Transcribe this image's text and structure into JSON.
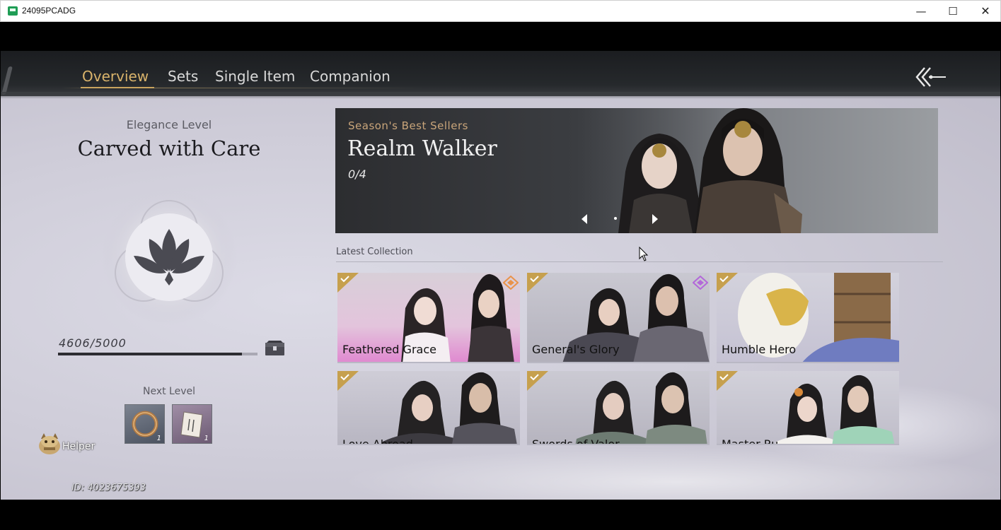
{
  "window": {
    "title": "24095PCADG",
    "minimize": "—",
    "maximize": "☐",
    "close": "✕"
  },
  "nav": {
    "tabs": [
      {
        "label": "Overview",
        "active": true
      },
      {
        "label": "Sets",
        "active": false
      },
      {
        "label": "Single Item",
        "active": false
      },
      {
        "label": "Companion",
        "active": false
      }
    ],
    "back_icon": "back-arrow-icon",
    "active_color": "#d9b36b"
  },
  "elegance": {
    "label": "Elegance Level",
    "name": "Carved with Care",
    "emblem_icon": "lotus-icon",
    "progress_text": "4606/5000",
    "progress_fraction": 0.9212,
    "reward_chest_icon": "chest-icon"
  },
  "next_level": {
    "label": "Next Level",
    "rewards": [
      {
        "icon": "ring-icon",
        "count": "1"
      },
      {
        "icon": "scroll-icon",
        "count": "1"
      }
    ]
  },
  "helper": {
    "label": "Helper",
    "icon": "helper-mascot-icon"
  },
  "player": {
    "id_text": "ID: 4023675393"
  },
  "banner": {
    "subtitle": "Season's Best Sellers",
    "title": "Realm Walker",
    "count": "0/4"
  },
  "collection": {
    "label": "Latest Collection",
    "items": [
      {
        "name": "Feathered Grace",
        "owned": true,
        "badge": "orange-diamond-icon"
      },
      {
        "name": "General's Glory",
        "owned": true,
        "badge": "purple-diamond-icon"
      },
      {
        "name": "Humble Hero",
        "owned": true,
        "badge": ""
      },
      {
        "name": "Love Abroad",
        "owned": true,
        "badge": ""
      },
      {
        "name": "Swords of Valor",
        "owned": true,
        "badge": ""
      },
      {
        "name": "Master Ru",
        "owned": true,
        "badge": ""
      }
    ]
  },
  "colors": {
    "accent_gold": "#c9a45e",
    "check_gold": "#c6a04e",
    "background": "#cfcdd9"
  }
}
